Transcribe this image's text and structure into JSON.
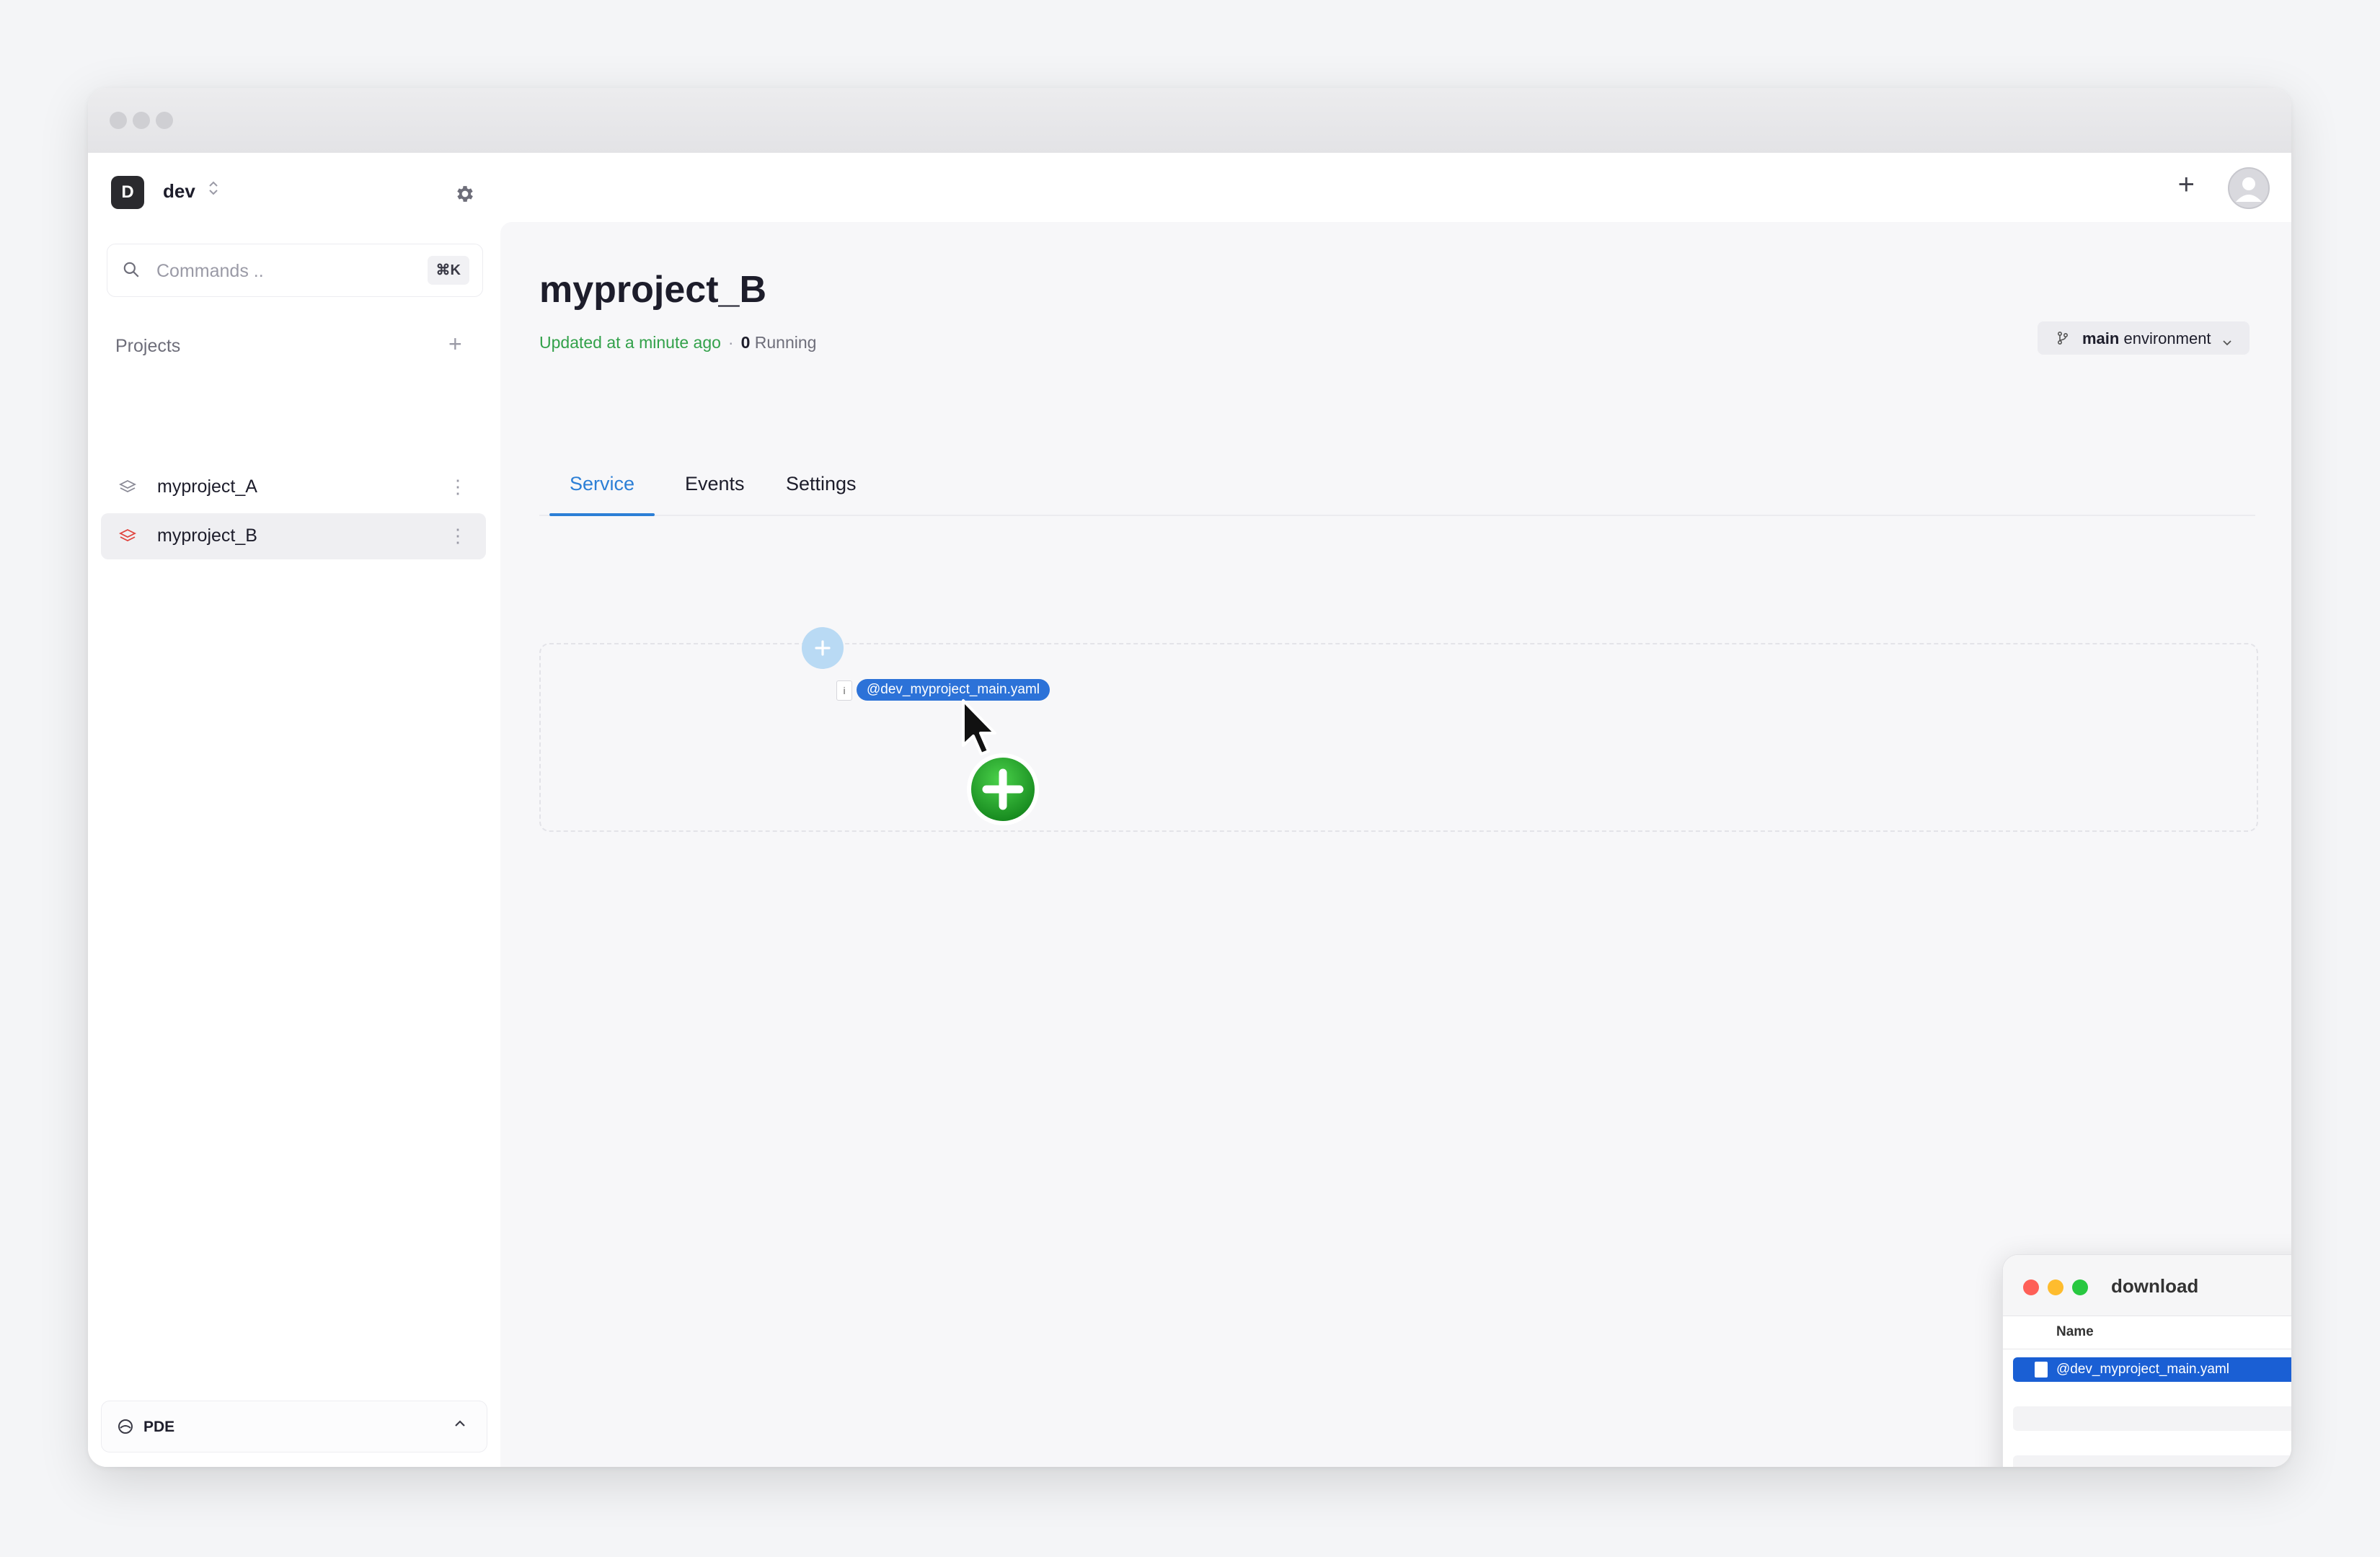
{
  "workspace": {
    "badge": "D",
    "name": "dev"
  },
  "search": {
    "placeholder": "Commands ..",
    "shortcut": "⌘K"
  },
  "projects": {
    "heading": "Projects",
    "items": [
      {
        "label": "myproject_A",
        "active": false
      },
      {
        "label": "myproject_B",
        "active": true
      }
    ]
  },
  "footer": {
    "label": "PDE"
  },
  "header": {
    "title": "myproject_B",
    "updated": "Updated at a minute ago",
    "separator": "·",
    "running_count": "0",
    "running_label": "Running",
    "environment_bold": "main",
    "environment_rest": " environment"
  },
  "tabs": [
    {
      "label": "Service",
      "active": true
    },
    {
      "label": "Events",
      "active": false
    },
    {
      "label": "Settings",
      "active": false
    }
  ],
  "drag": {
    "file_label": "@dev_myproject_main.yaml"
  },
  "finder": {
    "title": "download",
    "column_name": "Name",
    "selected_file": "@dev_myproject_main.yaml"
  },
  "colors": {
    "accent": "#2c7fd6",
    "updated_green": "#32a14a",
    "selection_blue": "#1a5fd4"
  }
}
